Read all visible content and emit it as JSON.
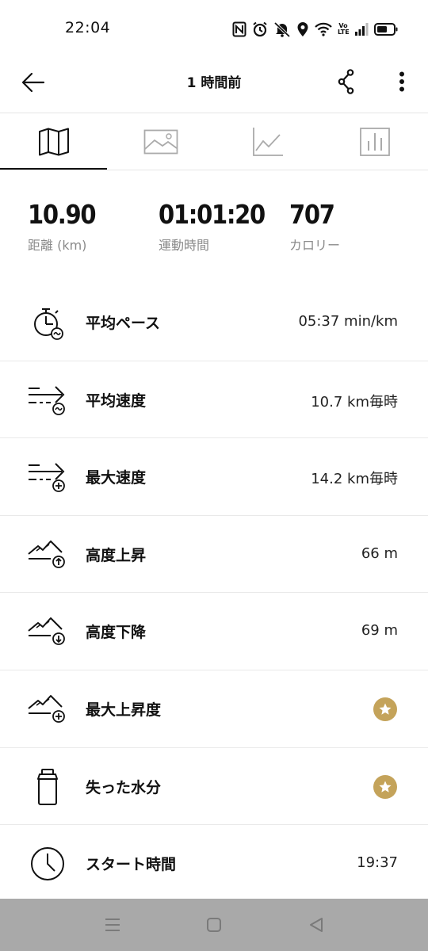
{
  "status_bar": {
    "time": "22:04",
    "volte_top": "Vo",
    "volte_bottom": "LTE",
    "icons": [
      "nfc-icon",
      "alarm-icon",
      "mute-icon",
      "location-icon",
      "wifi-icon",
      "signal-icon",
      "battery-icon"
    ]
  },
  "app_bar": {
    "title": "1 時間前",
    "icons": [
      "back-arrow-icon",
      "share-icon",
      "more-vert-icon"
    ]
  },
  "tabs": [
    {
      "icon": "map-icon",
      "active": true
    },
    {
      "icon": "photo-icon",
      "active": false
    },
    {
      "icon": "line-chart-icon",
      "active": false
    },
    {
      "icon": "bar-chart-icon",
      "active": false
    }
  ],
  "summary": {
    "distance": {
      "value": "10.90",
      "label": "距離 (km)"
    },
    "duration": {
      "value": "01:01:20",
      "label": "運動時間"
    },
    "calories": {
      "value": "707",
      "label": "カロリー"
    }
  },
  "stats": [
    {
      "label": "平均ペース",
      "value": "05:37 min/km",
      "icon": "pace-stopwatch-icon"
    },
    {
      "label": "平均速度",
      "value": "10.7 km毎時",
      "icon": "avg-speed-icon"
    },
    {
      "label": "最大速度",
      "value": "14.2 km毎時",
      "icon": "max-speed-icon"
    },
    {
      "label": "高度上昇",
      "value": "66 m",
      "icon": "ascent-icon"
    },
    {
      "label": "高度下降",
      "value": "69 m",
      "icon": "descent-icon"
    },
    {
      "label": "最大上昇度",
      "value": "",
      "icon": "max-ascent-icon",
      "premium": true
    },
    {
      "label": "失った水分",
      "value": "",
      "icon": "water-bottle-icon",
      "premium": true
    },
    {
      "label": "スタート時間",
      "value": "19:37",
      "icon": "clock-icon"
    }
  ],
  "colors": {
    "premium_badge": "#c4a35a",
    "nav_bar": "#a9a9a9",
    "label_gray": "#8a8a8a"
  },
  "nav_bar": {
    "icons": [
      "recent-apps-icon",
      "home-icon",
      "back-icon"
    ]
  }
}
